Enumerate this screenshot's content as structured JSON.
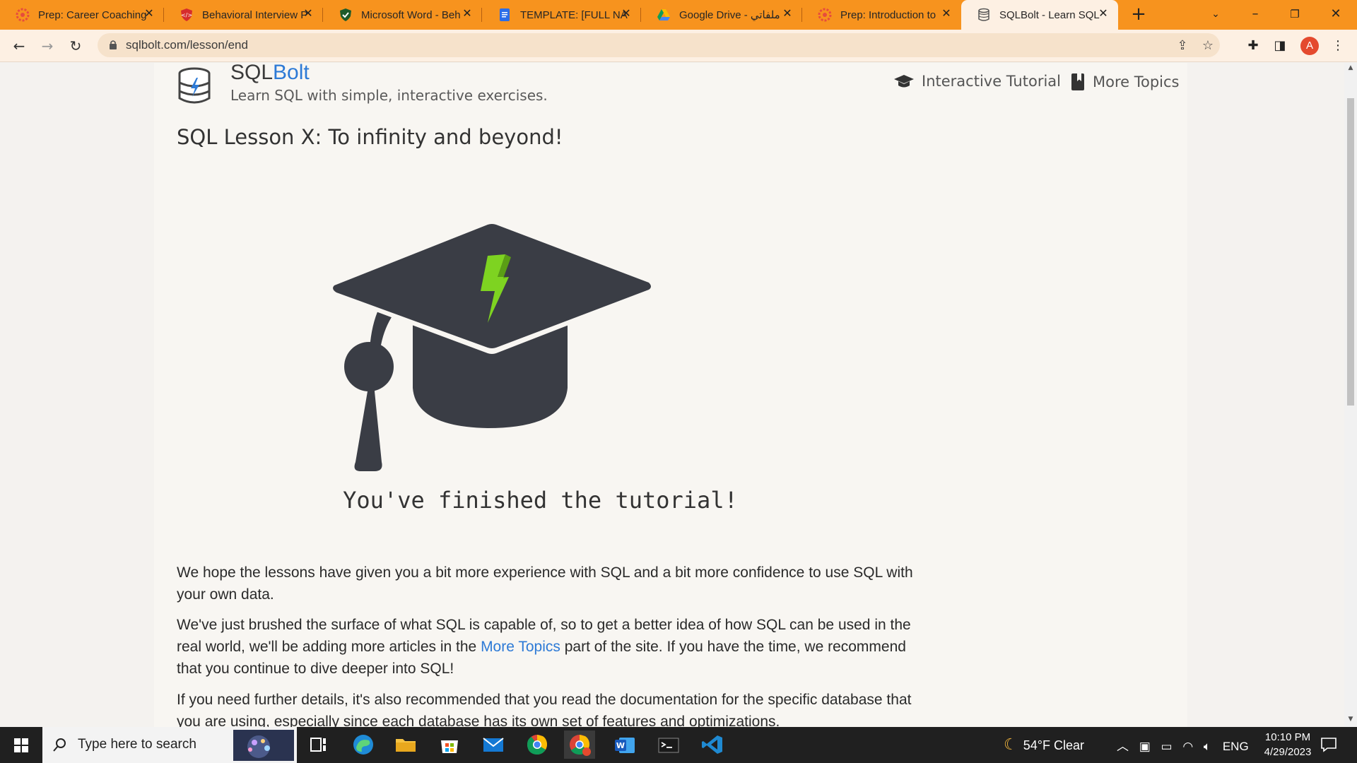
{
  "browser": {
    "tabs": [
      {
        "label": "Prep: Career Coaching",
        "icon": "pramp-icon"
      },
      {
        "label": "Behavioral Interview P",
        "icon": "shield-logo-icon"
      },
      {
        "label": "Microsoft Word - Beh",
        "icon": "shield-check-icon"
      },
      {
        "label": "TEMPLATE: [FULL NA",
        "icon": "google-docs-icon"
      },
      {
        "label": "Google Drive - ملفاتي",
        "icon": "google-drive-icon"
      },
      {
        "label": "Prep: Introduction to",
        "icon": "pramp-icon"
      },
      {
        "label": "SQLBolt - Learn SQL -",
        "icon": "sqlbolt-icon"
      }
    ],
    "url": "sqlbolt.com/lesson/end",
    "profile_initial": "A"
  },
  "site": {
    "brand_prefix": "SQL",
    "brand_suffix": "Bolt",
    "tagline": "Learn SQL with simple, interactive exercises.",
    "nav": {
      "tutorial": "Interactive Tutorial",
      "topics": "More Topics"
    }
  },
  "lesson": {
    "title": "SQL Lesson X: To infinity and beyond!",
    "finished": "You've finished the tutorial!",
    "p1": "We hope the lessons have given you a bit more experience with SQL and a bit more confidence to use SQL with your own data.",
    "p2_before": "We've just brushed the surface of what SQL is capable of, so to get a better idea of how SQL can be used in the real world, we'll be adding more articles in the ",
    "p2_link": "More Topics",
    "p2_after": " part of the site. If you have the time, we recommend that you continue to dive deeper into SQL!",
    "p3": "If you need further details, it's also recommended that you read the documentation for the specific database that you are using, especially since each database has its own set of features and optimizations."
  },
  "taskbar": {
    "search_placeholder": "Type here to search",
    "weather": "54°F  Clear",
    "language": "ENG",
    "time": "10:10 PM",
    "date": "4/29/2023"
  },
  "colors": {
    "tabbar": "#f7931e",
    "accent_blue": "#2d7ad6",
    "cap": "#3a3d45",
    "bolt": "#7ed321"
  }
}
